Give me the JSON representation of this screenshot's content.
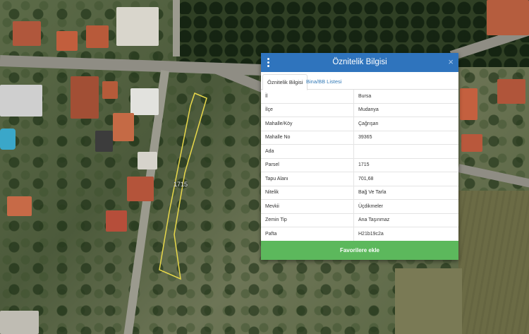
{
  "panel": {
    "title": "Öznitelik Bilgisi",
    "menu_icon": "vertical-dots-icon",
    "close_icon": "close-icon",
    "close_glyph": "×",
    "tabs": [
      {
        "label": "Öznitelik Bilgisi",
        "active": true
      },
      {
        "label": "Bina/BB Listesi",
        "active": false
      }
    ],
    "rows": [
      {
        "key": "İl",
        "value": "Bursa"
      },
      {
        "key": "İlçe",
        "value": "Mudanya"
      },
      {
        "key": "Mahalle/Köy",
        "value": "Çağrışan"
      },
      {
        "key": "Mahalle No",
        "value": "39365"
      },
      {
        "key": "Ada",
        "value": ""
      },
      {
        "key": "Parsel",
        "value": "1715"
      },
      {
        "key": "Tapu Alanı",
        "value": "701,68"
      },
      {
        "key": "Nitelik",
        "value": "Bağ Ve Tarla"
      },
      {
        "key": "Mevkii",
        "value": "Üçdikmeler"
      },
      {
        "key": "Zemin Tip",
        "value": "Ana Taşınmaz"
      },
      {
        "key": "Pafta",
        "value": "H21b19c2a"
      }
    ],
    "favorite_button": "Favorilere ekle"
  },
  "map": {
    "parcel_label": "1715",
    "parcel_outline_color": "#e8d84a"
  },
  "colors": {
    "header": "#2f74bd",
    "button": "#5cb85c",
    "tab_link": "#337ab7"
  }
}
